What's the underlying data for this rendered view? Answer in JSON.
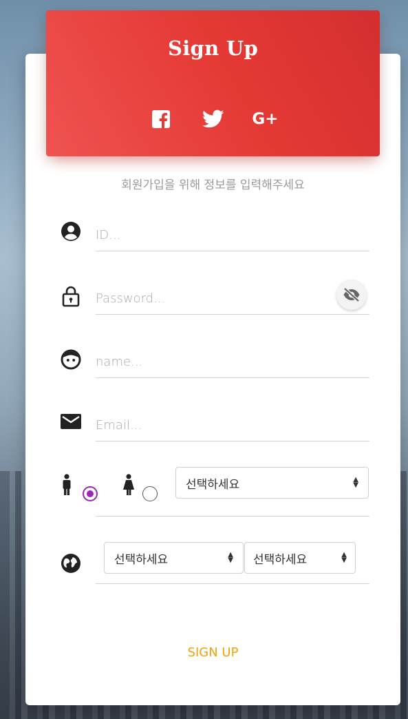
{
  "header": {
    "title": "Sign Up",
    "socials": [
      {
        "icon": "facebook-icon"
      },
      {
        "icon": "twitter-icon"
      },
      {
        "icon": "google-plus-icon",
        "label": "G+"
      }
    ]
  },
  "subtitle": "회원가입을 위해 정보를 입력해주세요",
  "form": {
    "id": {
      "placeholder": "ID...",
      "value": ""
    },
    "password": {
      "placeholder": "Password...",
      "value": ""
    },
    "name": {
      "placeholder": "name...",
      "value": ""
    },
    "email": {
      "placeholder": "Email...",
      "value": ""
    },
    "gender": {
      "male_selected": true,
      "female_selected": false,
      "select_value": "선택하세요"
    },
    "region": {
      "select1_value": "선택하세요",
      "select2_value": "선택하세요"
    },
    "submit_label": "SIGN UP"
  },
  "colors": {
    "header": "#e53935",
    "radio_accent": "#9c27b0",
    "submit": "#f0a30a"
  }
}
